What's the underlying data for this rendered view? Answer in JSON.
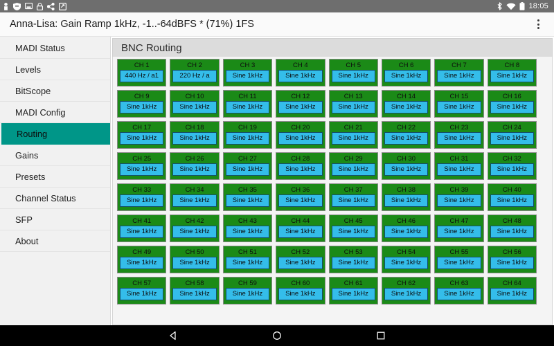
{
  "status_bar": {
    "background": "#6e6e6e",
    "clock": "18:05",
    "left_icons": [
      {
        "name": "person-icon",
        "glyph": "person"
      },
      {
        "name": "shield-icon",
        "glyph": "shield"
      },
      {
        "name": "screenshot-icon",
        "glyph": "screen"
      },
      {
        "name": "lock-icon",
        "glyph": "lock"
      },
      {
        "name": "share-icon",
        "glyph": "share"
      },
      {
        "name": "app-notification-icon",
        "glyph": "box"
      }
    ],
    "right_icons": [
      {
        "name": "bluetooth-icon",
        "glyph": "bluetooth"
      },
      {
        "name": "wifi-icon",
        "glyph": "wifi"
      },
      {
        "name": "battery-icon",
        "glyph": "battery"
      }
    ]
  },
  "app_bar": {
    "title": "Anna-Lisa: Gain Ramp 1kHz, -1..-64dBFS * (71%) 1FS",
    "overflow_label": "More options"
  },
  "sidebar": {
    "active_color": "#009688",
    "active_index": 4,
    "items": [
      {
        "label": "MADI Status"
      },
      {
        "label": "Levels"
      },
      {
        "label": "BitScope"
      },
      {
        "label": "MADI Config"
      },
      {
        "label": "Routing"
      },
      {
        "label": "Gains"
      },
      {
        "label": "Presets"
      },
      {
        "label": "Channel Status"
      },
      {
        "label": "SFP"
      },
      {
        "label": "About"
      }
    ]
  },
  "main": {
    "section_title": "BNC Routing",
    "cell_color": "#1b8a17",
    "button_color": "#34bdea",
    "channels": [
      {
        "label": "CH 1",
        "source": "440 Hz / a1"
      },
      {
        "label": "CH 2",
        "source": "220 Hz / a"
      },
      {
        "label": "CH 3",
        "source": "Sine 1kHz"
      },
      {
        "label": "CH 4",
        "source": "Sine 1kHz"
      },
      {
        "label": "CH 5",
        "source": "Sine 1kHz"
      },
      {
        "label": "CH 6",
        "source": "Sine 1kHz"
      },
      {
        "label": "CH 7",
        "source": "Sine 1kHz"
      },
      {
        "label": "CH 8",
        "source": "Sine 1kHz"
      },
      {
        "label": "CH 9",
        "source": "Sine 1kHz"
      },
      {
        "label": "CH 10",
        "source": "Sine 1kHz"
      },
      {
        "label": "CH 11",
        "source": "Sine 1kHz"
      },
      {
        "label": "CH 12",
        "source": "Sine 1kHz"
      },
      {
        "label": "CH 13",
        "source": "Sine 1kHz"
      },
      {
        "label": "CH 14",
        "source": "Sine 1kHz"
      },
      {
        "label": "CH 15",
        "source": "Sine 1kHz"
      },
      {
        "label": "CH 16",
        "source": "Sine 1kHz"
      },
      {
        "label": "CH 17",
        "source": "Sine 1kHz"
      },
      {
        "label": "CH 18",
        "source": "Sine 1kHz"
      },
      {
        "label": "CH 19",
        "source": "Sine 1kHz"
      },
      {
        "label": "CH 20",
        "source": "Sine 1kHz"
      },
      {
        "label": "CH 21",
        "source": "Sine 1kHz"
      },
      {
        "label": "CH 22",
        "source": "Sine 1kHz"
      },
      {
        "label": "CH 23",
        "source": "Sine 1kHz"
      },
      {
        "label": "CH 24",
        "source": "Sine 1kHz"
      },
      {
        "label": "CH 25",
        "source": "Sine 1kHz"
      },
      {
        "label": "CH 26",
        "source": "Sine 1kHz"
      },
      {
        "label": "CH 27",
        "source": "Sine 1kHz"
      },
      {
        "label": "CH 28",
        "source": "Sine 1kHz"
      },
      {
        "label": "CH 29",
        "source": "Sine 1kHz"
      },
      {
        "label": "CH 30",
        "source": "Sine 1kHz"
      },
      {
        "label": "CH 31",
        "source": "Sine 1kHz"
      },
      {
        "label": "CH 32",
        "source": "Sine 1kHz"
      },
      {
        "label": "CH 33",
        "source": "Sine 1kHz"
      },
      {
        "label": "CH 34",
        "source": "Sine 1kHz"
      },
      {
        "label": "CH 35",
        "source": "Sine 1kHz"
      },
      {
        "label": "CH 36",
        "source": "Sine 1kHz"
      },
      {
        "label": "CH 37",
        "source": "Sine 1kHz"
      },
      {
        "label": "CH 38",
        "source": "Sine 1kHz"
      },
      {
        "label": "CH 39",
        "source": "Sine 1kHz"
      },
      {
        "label": "CH 40",
        "source": "Sine 1kHz"
      },
      {
        "label": "CH 41",
        "source": "Sine 1kHz"
      },
      {
        "label": "CH 42",
        "source": "Sine 1kHz"
      },
      {
        "label": "CH 43",
        "source": "Sine 1kHz"
      },
      {
        "label": "CH 44",
        "source": "Sine 1kHz"
      },
      {
        "label": "CH 45",
        "source": "Sine 1kHz"
      },
      {
        "label": "CH 46",
        "source": "Sine 1kHz"
      },
      {
        "label": "CH 47",
        "source": "Sine 1kHz"
      },
      {
        "label": "CH 48",
        "source": "Sine 1kHz"
      },
      {
        "label": "CH 49",
        "source": "Sine 1kHz"
      },
      {
        "label": "CH 50",
        "source": "Sine 1kHz"
      },
      {
        "label": "CH 51",
        "source": "Sine 1kHz"
      },
      {
        "label": "CH 52",
        "source": "Sine 1kHz"
      },
      {
        "label": "CH 53",
        "source": "Sine 1kHz"
      },
      {
        "label": "CH 54",
        "source": "Sine 1kHz"
      },
      {
        "label": "CH 55",
        "source": "Sine 1kHz"
      },
      {
        "label": "CH 56",
        "source": "Sine 1kHz"
      },
      {
        "label": "CH 57",
        "source": "Sine 1kHz"
      },
      {
        "label": "CH 58",
        "source": "Sine 1kHz"
      },
      {
        "label": "CH 59",
        "source": "Sine 1kHz"
      },
      {
        "label": "CH 60",
        "source": "Sine 1kHz"
      },
      {
        "label": "CH 61",
        "source": "Sine 1kHz"
      },
      {
        "label": "CH 62",
        "source": "Sine 1kHz"
      },
      {
        "label": "CH 63",
        "source": "Sine 1kHz"
      },
      {
        "label": "CH 64",
        "source": "Sine 1kHz"
      }
    ]
  },
  "nav_bar": {
    "buttons": [
      {
        "name": "back-button",
        "glyph": "triangle"
      },
      {
        "name": "home-button",
        "glyph": "circle"
      },
      {
        "name": "recents-button",
        "glyph": "square"
      }
    ]
  }
}
